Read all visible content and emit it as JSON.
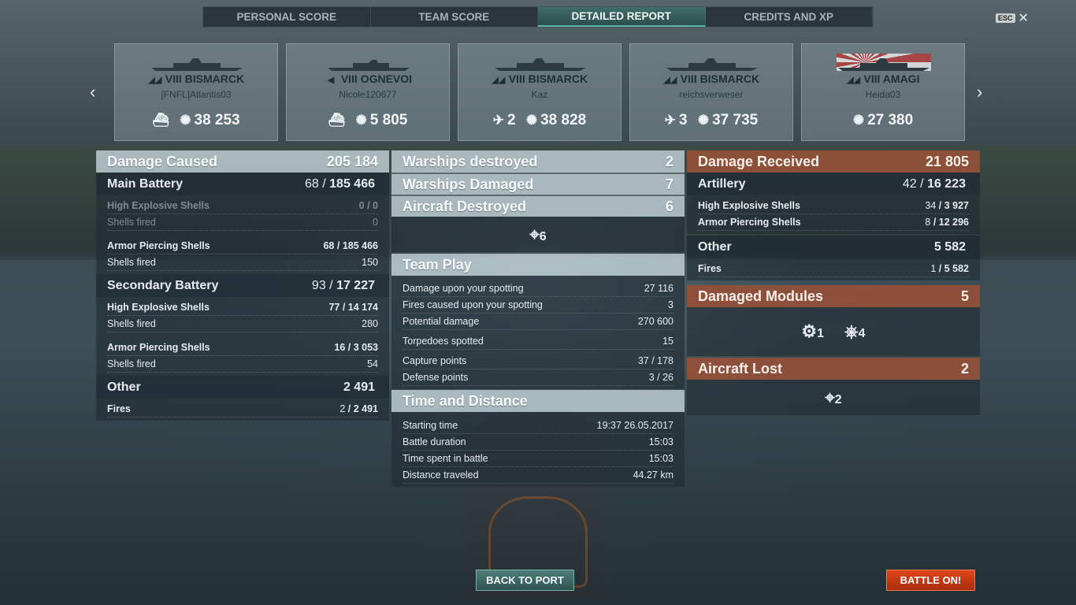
{
  "tabs": [
    "PERSONAL SCORE",
    "TEAM SCORE",
    "DETAILED REPORT",
    "CREDITS AND XP"
  ],
  "esc": {
    "key": "ESC",
    "close": "✕"
  },
  "cards": [
    {
      "tier": "VIII BISMARCK",
      "player": "[FNFL]Atlantis03",
      "stat1": "",
      "stat2": "38 253"
    },
    {
      "tier": "VIII OGNEVOI",
      "player": "Nicole120677",
      "stat1": "",
      "stat2": "5 805"
    },
    {
      "tier": "VIII BISMARCK",
      "player": "Kaz",
      "stat1": "2",
      "stat2": "38 828"
    },
    {
      "tier": "VIII BISMARCK",
      "player": "reichsverweser",
      "stat1": "3",
      "stat2": "37 735"
    },
    {
      "tier": "VIII AMAGI",
      "player": "Heida03",
      "stat1": "",
      "stat2": "27 380"
    }
  ],
  "left": {
    "title": "Damage Caused",
    "total": "205 184",
    "main": {
      "label": "Main Battery",
      "hits": "68",
      "dmg": "185 466",
      "he_label": "High Explosive Shells",
      "he_hits": "0",
      "he_dmg": "0",
      "he_fired_label": "Shells fired",
      "he_fired": "0",
      "ap_label": "Armor Piercing Shells",
      "ap_hits": "68",
      "ap_dmg": "185 466",
      "ap_fired_label": "Shells fired",
      "ap_fired": "150"
    },
    "secondary": {
      "label": "Secondary Battery",
      "hits": "93",
      "dmg": "17 227",
      "he_label": "High Explosive Shells",
      "he_hits": "77",
      "he_dmg": "14 174",
      "he_fired_label": "Shells fired",
      "he_fired": "280",
      "ap_label": "Armor Piercing Shells",
      "ap_hits": "16",
      "ap_dmg": "3 053",
      "ap_fired_label": "Shells fired",
      "ap_fired": "54"
    },
    "other": {
      "label": "Other",
      "total": "2 491",
      "fires_label": "Fires",
      "fires_hits": "2",
      "fires_dmg": "2 491"
    }
  },
  "middle": {
    "destroyed": {
      "label": "Warships destroyed",
      "value": "2"
    },
    "damaged": {
      "label": "Warships Damaged",
      "value": "7"
    },
    "aircraft": {
      "label": "Aircraft Destroyed",
      "value": "6",
      "icon_count": "6"
    },
    "team_play": {
      "label": "Team Play",
      "rows": [
        {
          "k": "Damage upon your spotting",
          "v": "27 116"
        },
        {
          "k": "Fires caused upon your spotting",
          "v": "3"
        },
        {
          "k": "Potential damage",
          "v": "270 600"
        },
        {
          "k": "Torpedoes spotted",
          "v": "15"
        },
        {
          "k": "Capture points",
          "v": "37 / 178"
        },
        {
          "k": "Defense points",
          "v": "3 / 26"
        }
      ]
    },
    "time": {
      "label": "Time and Distance",
      "rows": [
        {
          "k": "Starting time",
          "v": "19:37  26.05.2017"
        },
        {
          "k": "Battle duration",
          "v": "15:03"
        },
        {
          "k": "Time spent in battle",
          "v": "15:03"
        },
        {
          "k": "Distance traveled",
          "v": "44.27 km"
        }
      ]
    }
  },
  "right": {
    "title": "Damage Received",
    "total": "21 805",
    "artillery": {
      "label": "Artillery",
      "hits": "42",
      "dmg": "16 223",
      "he_label": "High Explosive Shells",
      "he_hits": "34",
      "he_dmg": "3 927",
      "ap_label": "Armor Piercing Shells",
      "ap_hits": "8",
      "ap_dmg": "12 296"
    },
    "other": {
      "label": "Other",
      "total": "5 582",
      "fires_label": "Fires",
      "fires_hits": "1",
      "fires_dmg": "5 582"
    },
    "modules": {
      "label": "Damaged Modules",
      "value": "5",
      "m1": "1",
      "m2": "4"
    },
    "aircraft_lost": {
      "label": "Aircraft Lost",
      "value": "2",
      "icon_count": "2"
    }
  },
  "buttons": {
    "port": "BACK TO PORT",
    "battle": "BATTLE ON!"
  }
}
